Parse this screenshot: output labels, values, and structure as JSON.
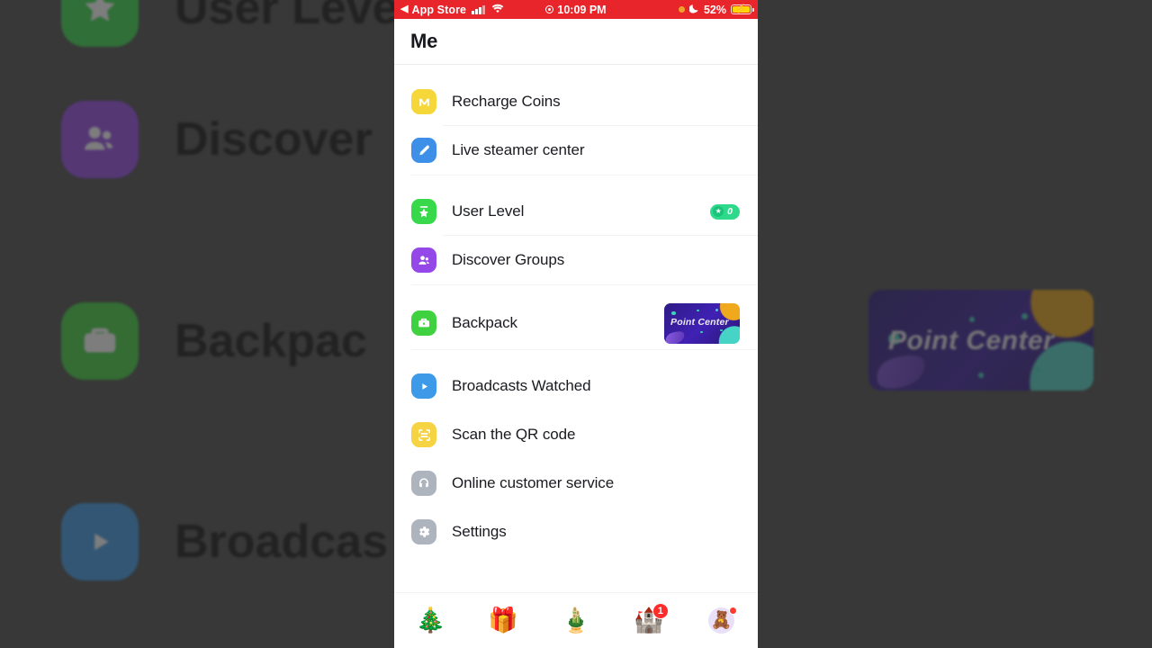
{
  "status_bar": {
    "back_glyph": "◀",
    "carrier_label": "App Store",
    "signal_icon": "cellular-signal-icon",
    "wifi_icon": "wifi-icon",
    "location_icon": "location-services-icon",
    "time": "10:09 PM",
    "orange_dot_icon": "orange-status-dot-icon",
    "moon_icon": "do-not-disturb-moon-icon",
    "battery_percent": "52%",
    "battery_icon": "charging-battery-icon",
    "bolt_glyph": "⚡",
    "bg_color": "#e8252a"
  },
  "header": {
    "title": "Me"
  },
  "menu": {
    "groups": [
      {
        "rows": [
          {
            "label": "Recharge Coins",
            "icon_name": "coin-m-icon",
            "icon_color": "#f5d73a",
            "glyph": "M",
            "right": "none"
          },
          {
            "label": "Live steamer center",
            "icon_name": "microphone-icon",
            "icon_color": "#3d8fe8",
            "glyph": "🎤",
            "right": "none"
          }
        ]
      },
      {
        "rows": [
          {
            "label": "User Level",
            "icon_name": "star-badge-icon",
            "icon_color": "#37d94a",
            "glyph": "★",
            "right": "level_badge"
          },
          {
            "label": "Discover Groups",
            "icon_name": "people-group-icon",
            "icon_color": "#9548e8",
            "glyph": "👥",
            "right": "none"
          }
        ]
      },
      {
        "rows": [
          {
            "label": "Backpack",
            "icon_name": "briefcase-icon",
            "icon_color": "#3fd13f",
            "glyph": "💼",
            "right": "point_banner"
          }
        ]
      },
      {
        "rows": [
          {
            "label": "Broadcasts Watched",
            "icon_name": "play-circle-icon",
            "icon_color": "#3d9ae8",
            "glyph": "▶",
            "right": "none"
          },
          {
            "label": "Scan the QR code",
            "icon_name": "qr-scan-icon",
            "icon_color": "#f5d343",
            "glyph": "⌗",
            "right": "none"
          },
          {
            "label": "Online customer service",
            "icon_name": "headset-support-icon",
            "icon_color": "#adb4be",
            "glyph": "🎧",
            "right": "none"
          },
          {
            "label": "Settings",
            "icon_name": "gear-icon",
            "icon_color": "#adb4be",
            "glyph": "⚙",
            "right": "none"
          }
        ]
      }
    ],
    "level_badge": {
      "star_glyph": "★",
      "value": "0",
      "color": "#2fd98c"
    },
    "point_banner": {
      "text": "Point Center",
      "bg_color": "#3a1f9e"
    }
  },
  "tabbar": {
    "tabs": [
      {
        "icon_name": "christmas-tree-tab-icon",
        "emoji": "🎄",
        "badge": "",
        "dot": false
      },
      {
        "icon_name": "gift-box-tab-icon",
        "emoji": "🎁",
        "badge": "",
        "dot": false
      },
      {
        "icon_name": "live-wreath-tab-icon",
        "emoji": "🎍",
        "badge": "",
        "dot": false
      },
      {
        "icon_name": "messages-castle-tab-icon",
        "emoji": "🏰",
        "badge": "1",
        "dot": false
      },
      {
        "icon_name": "profile-avatar-tab-icon",
        "emoji": "🧸",
        "badge": "",
        "dot": true
      }
    ],
    "badge_color": "#ff2c2c"
  },
  "background": {
    "left_rows": [
      {
        "label": "User Level",
        "icon_name": "star-badge-icon",
        "icon_color": "#37d94a"
      },
      {
        "label": "Discover",
        "icon_name": "people-group-icon",
        "icon_color": "#9548e8"
      },
      {
        "label": "Backpac",
        "icon_name": "briefcase-icon",
        "icon_color": "#3fd13f"
      },
      {
        "label": "Broadcas",
        "icon_name": "play-circle-icon",
        "icon_color": "#3d9ae8"
      }
    ],
    "right_banner_text": "Point Center",
    "overlay_color": "#2d2d2d"
  }
}
